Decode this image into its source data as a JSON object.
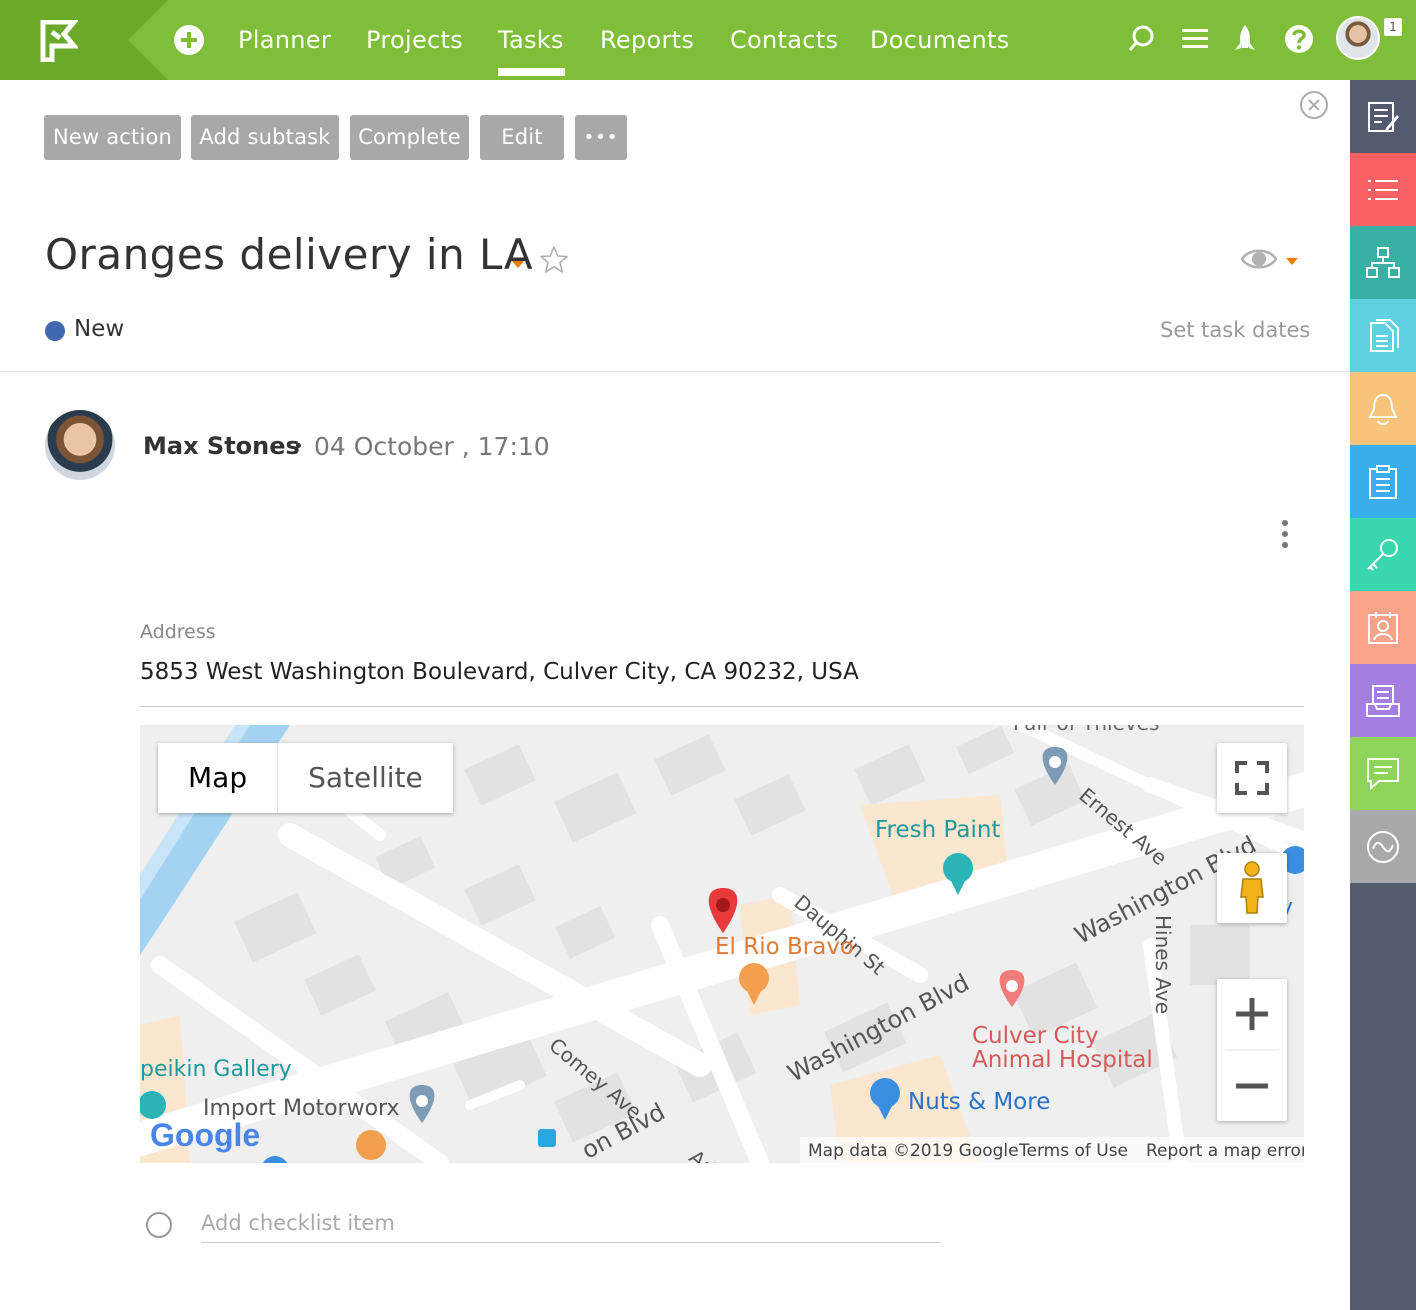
{
  "nav": {
    "items": [
      "Planner",
      "Projects",
      "Tasks",
      "Reports",
      "Contacts",
      "Documents"
    ],
    "active": "Tasks",
    "notification_count": "1",
    "colors": {
      "bar": "#7fbe38",
      "logo_area": "#6aa92a"
    }
  },
  "toolbar": {
    "new_action": "New action",
    "add_subtask": "Add subtask",
    "complete": "Complete",
    "edit": "Edit",
    "more": "•••"
  },
  "task": {
    "title": "Oranges delivery in LA",
    "status": "New",
    "status_color": "#4169b0",
    "set_dates": "Set task dates"
  },
  "comment": {
    "author": "Max Stones",
    "date": "04 October , 17:10"
  },
  "address": {
    "label": "Address",
    "value": "5853 West Washington Boulevard, Culver City, CA 90232, USA"
  },
  "map": {
    "type_map": "Map",
    "type_satellite": "Satellite",
    "labels": {
      "pair_of_thieves": "Pair of Thieves",
      "ernest_ave": "Ernest Ave",
      "fresh_paint": "Fresh Paint",
      "washington_blvd_1": "Washington Blvd",
      "washington_blvd_2": "Washington Blvd",
      "washington_blvd_3": "on Blvd",
      "dauphin_st": "Dauphin St",
      "el_rio_bravo": "El Rio Bravo",
      "hines_ave": "Hines Ave",
      "culver_city_1": "Culver City",
      "culver_city_2": "Animal Hospital",
      "comey_ave": "Comey Ave",
      "peikin_gallery": "peikin Gallery",
      "import_motorworx": "Import Motorworx",
      "nuts_more": "Nuts & More",
      "google": "Google",
      "y_partial": "y",
      "ad_partial": "Ad"
    },
    "footer": {
      "data": "Map data ©2019 Google",
      "terms": "Terms of Use",
      "report": "Report a map error"
    }
  },
  "checklist": {
    "placeholder": "Add checklist item"
  },
  "sidebar": {
    "items": [
      {
        "icon": "notes-icon",
        "color": "#555b6e"
      },
      {
        "icon": "list-icon",
        "color": "#f96064"
      },
      {
        "icon": "hierarchy-icon",
        "color": "#3ab0a4"
      },
      {
        "icon": "documents-icon",
        "color": "#5fd0e0"
      },
      {
        "icon": "bell-icon",
        "color": "#f8c47c"
      },
      {
        "icon": "clipboard-icon",
        "color": "#3aaeea"
      },
      {
        "icon": "key-icon",
        "color": "#3ad6ae"
      },
      {
        "icon": "contact-card-icon",
        "color": "#f9a38a"
      },
      {
        "icon": "inbox-icon",
        "color": "#a47ee0"
      },
      {
        "icon": "chat-icon",
        "color": "#8fd45a"
      },
      {
        "icon": "activity-icon",
        "color": "#a9a9a9"
      }
    ]
  }
}
